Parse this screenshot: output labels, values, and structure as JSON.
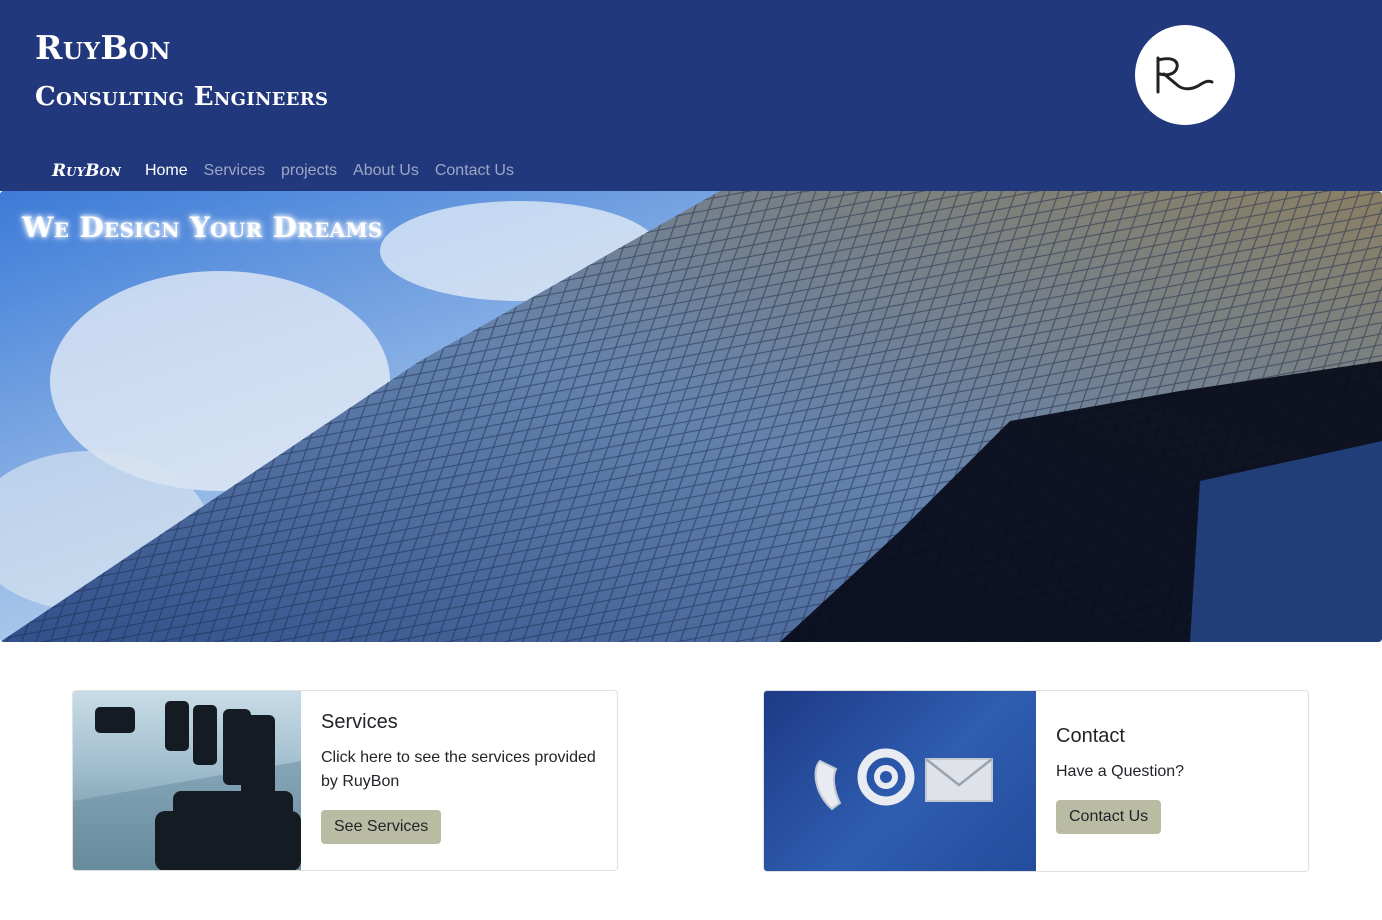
{
  "header": {
    "brand_title": "RuyBon",
    "brand_subtitle": "Consulting Engineers",
    "logo_text": "R"
  },
  "navbar": {
    "brand": "RuyBon",
    "links": [
      "Home",
      "Services",
      "projects",
      "About Us",
      "Contact Us"
    ],
    "active": "Home"
  },
  "hero": {
    "tagline": "We Design Your Dreams"
  },
  "cards": {
    "services": {
      "title": "Services",
      "text": "Click here to see the services provided by RuyBon",
      "button": "See Services"
    },
    "contact": {
      "title": "Contact",
      "text": "Have a Question?",
      "button": "Contact Us"
    }
  },
  "colors": {
    "header_bg": "#22387c",
    "button_bg": "#b9bca3",
    "nav_inactive": "rgba(255,255,255,0.55)"
  },
  "icons": [
    "logo-icon",
    "phone-icon",
    "at-sign-icon",
    "envelope-icon"
  ]
}
